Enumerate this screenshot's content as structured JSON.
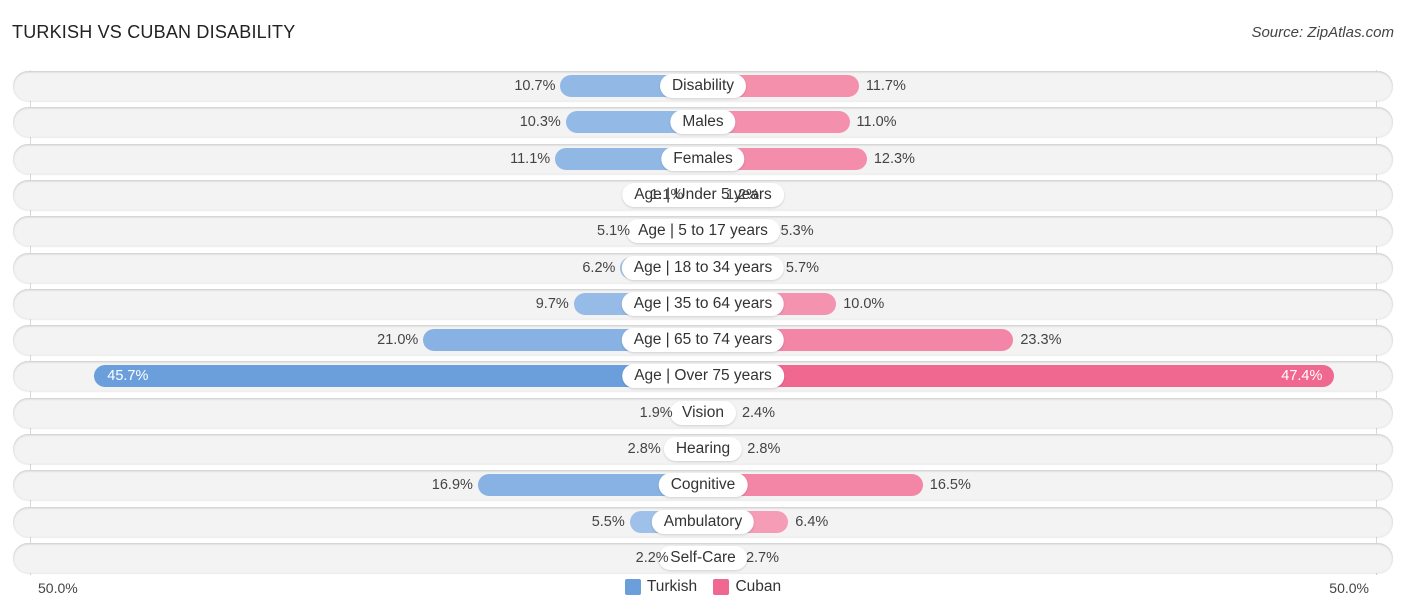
{
  "title": "TURKISH VS CUBAN DISABILITY",
  "source": "Source: ZipAtlas.com",
  "chart_data": {
    "type": "bar",
    "orientation": "horizontal-diverging",
    "title": "TURKISH VS CUBAN DISABILITY",
    "categories": [
      "Disability",
      "Males",
      "Females",
      "Age | Under 5 years",
      "Age | 5 to 17 years",
      "Age | 18 to 34 years",
      "Age | 35 to 64 years",
      "Age | 65 to 74 years",
      "Age | Over 75 years",
      "Vision",
      "Hearing",
      "Cognitive",
      "Ambulatory",
      "Self-Care"
    ],
    "series": [
      {
        "name": "Turkish",
        "color": "#6a9fdc",
        "values": [
          10.7,
          10.3,
          11.1,
          1.1,
          5.1,
          6.2,
          9.7,
          21.0,
          45.7,
          1.9,
          2.8,
          16.9,
          5.5,
          2.2
        ]
      },
      {
        "name": "Cuban",
        "color": "#f06890",
        "values": [
          11.7,
          11.0,
          12.3,
          1.2,
          5.3,
          5.7,
          10.0,
          23.3,
          47.4,
          2.4,
          2.8,
          16.5,
          6.4,
          2.7
        ]
      }
    ],
    "value_labels": {
      "Turkish": [
        "10.7%",
        "10.3%",
        "11.1%",
        "1.1%",
        "5.1%",
        "6.2%",
        "9.7%",
        "21.0%",
        "45.7%",
        "1.9%",
        "2.8%",
        "16.9%",
        "5.5%",
        "2.2%"
      ],
      "Cuban": [
        "11.7%",
        "11.0%",
        "12.3%",
        "1.2%",
        "5.3%",
        "5.7%",
        "10.0%",
        "23.3%",
        "47.4%",
        "2.4%",
        "2.8%",
        "16.5%",
        "6.4%",
        "2.7%"
      ]
    },
    "xlim": [
      -50,
      50
    ],
    "axis_labels": {
      "left": "50.0%",
      "right": "50.0%"
    },
    "legend": {
      "position": "bottom-center",
      "entries": [
        "Turkish",
        "Cuban"
      ]
    },
    "grid": false
  }
}
